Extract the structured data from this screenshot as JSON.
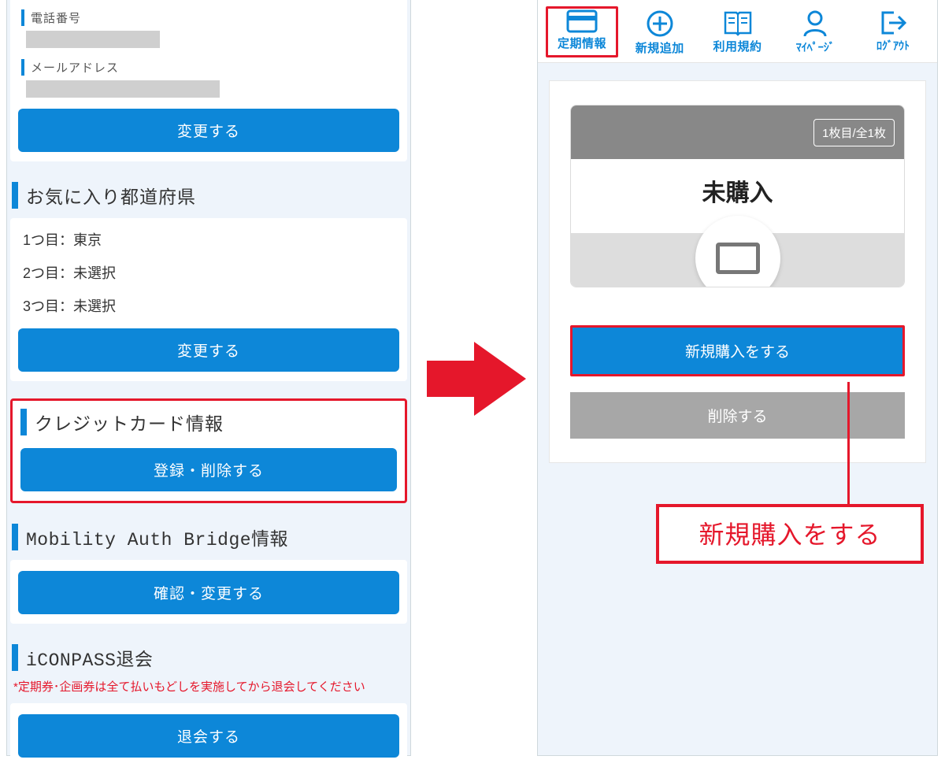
{
  "left": {
    "phone": {
      "label": "電話番号"
    },
    "email": {
      "label": "メールアドレス"
    },
    "change_btn": "変更する",
    "pref": {
      "title": "お気に入り都道府県",
      "items": [
        "1つ目：東京",
        "2つ目：未選択",
        "3つ目：未選択"
      ],
      "btn": "変更する"
    },
    "cc": {
      "title": "クレジットカード情報",
      "btn": "登録・削除する"
    },
    "mab": {
      "title": "Mobility Auth Bridge情報",
      "btn": "確認・変更する"
    },
    "withdraw": {
      "title": "iCONPASS退会",
      "note": "*定期券･企画券は全て払いもどしを実施してから退会してください",
      "btn": "退会する"
    }
  },
  "right": {
    "nav": {
      "periodic": "定期情報",
      "add": "新規追加",
      "terms": "利用規約",
      "mypage": "ﾏｲﾍﾟｰｼﾞ",
      "logout": "ﾛｸﾞｱｳﾄ"
    },
    "ticket": {
      "pager": "1枚目/全1枚",
      "status": "未購入",
      "buy_btn": "新規購入をする",
      "delete_btn": "削除する"
    }
  },
  "callout": "新規購入をする"
}
